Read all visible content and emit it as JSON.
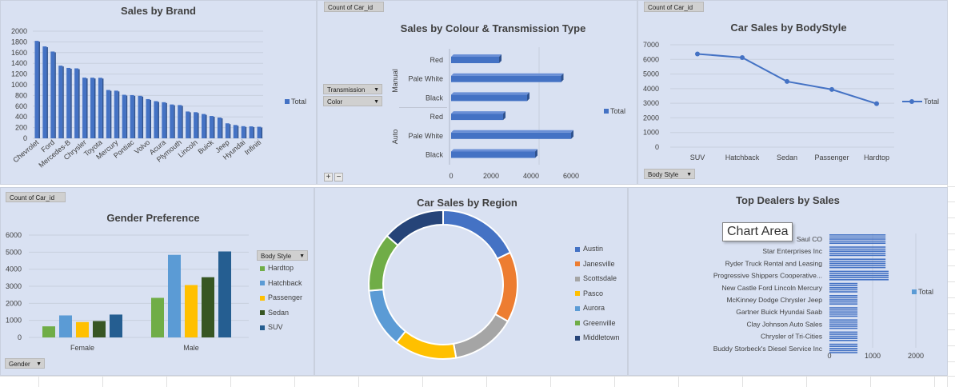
{
  "brand": {
    "title": "Sales by Brand",
    "legend": "Total",
    "chart_data": {
      "type": "bar",
      "title": "Sales by Brand",
      "categories": [
        "Chevrolet",
        "Ford",
        "Mercedes-B",
        "Chrysler",
        "Toyota",
        "Mercury",
        "Pontiac",
        "Volvo",
        "Acura",
        "Plymouth",
        "Lincoln",
        "Buick",
        "Jeep",
        "Hyundai",
        "Infiniti"
      ],
      "values": [
        1819,
        1716,
        1620,
        1357,
        1314,
        1306,
        1133,
        1132,
        1130,
        902,
        890,
        813,
        807,
        794,
        732,
        694,
        674,
        632,
        621,
        501,
        488,
        454,
        417,
        388,
        280,
        249,
        227,
        223,
        216
      ],
      "yticks": [
        0,
        200,
        400,
        600,
        800,
        1000,
        1200,
        1400,
        1600,
        1800,
        2000
      ],
      "ylim": [
        0,
        2000
      ],
      "series": [
        {
          "name": "Total"
        }
      ],
      "legend_position": "right",
      "grid": true
    }
  },
  "colour": {
    "title": "Sales by Colour & Transmission Type",
    "button_count": "Count of Car_id",
    "filter_transmission": "Transmission",
    "filter_color": "Color",
    "legend": "Total",
    "plus": "+",
    "minus": "−",
    "chart_data": {
      "type": "bar",
      "orientation": "horizontal",
      "title": "Sales by Colour & Transmission Type",
      "groups": [
        "Manual",
        "Auto"
      ],
      "categories": [
        "Red",
        "Pale White",
        "Black",
        "Red",
        "Pale White",
        "Black"
      ],
      "category_groups": [
        "Manual",
        "Manual",
        "Manual",
        "Auto",
        "Auto",
        "Auto"
      ],
      "values": [
        2400,
        5500,
        3800,
        2600,
        6000,
        4200
      ],
      "xticks": [
        0,
        2000,
        4000,
        6000
      ],
      "xlim": [
        0,
        7000
      ],
      "series": [
        {
          "name": "Total"
        }
      ],
      "legend_position": "right"
    }
  },
  "body": {
    "title": "Car Sales by BodyStyle",
    "button_count": "Count of Car_id",
    "filter_body": "Body Style",
    "legend": "Total",
    "chart_data": {
      "type": "line",
      "title": "Car Sales by BodyStyle",
      "categories": [
        "SUV",
        "Hatchback",
        "Sedan",
        "Passenger",
        "Hardtop"
      ],
      "values": [
        6374,
        6128,
        4488,
        3945,
        2971
      ],
      "yticks": [
        0,
        1000,
        2000,
        3000,
        4000,
        5000,
        6000,
        7000
      ],
      "ylim": [
        0,
        7000
      ],
      "series": [
        {
          "name": "Total"
        }
      ],
      "legend_position": "right",
      "grid": true
    }
  },
  "gender": {
    "title": "Gender Preference",
    "button_count": "Count of Car_id",
    "filter_gender": "Gender",
    "filter_body": "Body Style",
    "chart_data": {
      "type": "bar",
      "title": "Gender Preference",
      "categories": [
        "Female",
        "Male"
      ],
      "yticks": [
        0,
        1000,
        2000,
        3000,
        4000,
        5000,
        6000
      ],
      "ylim": [
        0,
        6000
      ],
      "series": [
        {
          "name": "Hardtop",
          "values": [
            650,
            2320
          ],
          "color": "#70ad47"
        },
        {
          "name": "Hatchback",
          "values": [
            1290,
            4840
          ],
          "color": "#5b9bd5"
        },
        {
          "name": "Passenger",
          "values": [
            900,
            3070
          ],
          "color": "#ffc000"
        },
        {
          "name": "Sedan",
          "values": [
            960,
            3530
          ],
          "color": "#375623"
        },
        {
          "name": "SUV",
          "values": [
            1340,
            5040
          ],
          "color": "#255e91"
        }
      ],
      "legend_position": "right",
      "grid": true
    }
  },
  "region": {
    "title": "Car Sales by Region",
    "chart_data": {
      "type": "pie",
      "donut": true,
      "title": "Car Sales by Region",
      "labels": [
        "Austin",
        "Janesville",
        "Scottsdale",
        "Pasco",
        "Aurora",
        "Greenville",
        "Middletown"
      ],
      "values": [
        17.9,
        15.3,
        14.0,
        13.6,
        12.9,
        12.7,
        13.6
      ],
      "colors": [
        "#4472c4",
        "#ed7d31",
        "#a5a5a5",
        "#ffc000",
        "#5b9bd5",
        "#70ad47",
        "#264478"
      ],
      "legend_position": "right"
    }
  },
  "dealers": {
    "title": "Top Dealers by Sales",
    "tooltip": "Chart Area",
    "legend": "Total",
    "chart_data": {
      "type": "bar",
      "orientation": "horizontal",
      "title": "Top Dealers by Sales",
      "categories": [
        "Saul CO",
        "Star Enterprises Inc",
        "Ryder Truck Rental and Leasing",
        "Progressive Shippers Cooperative...",
        "New Castle Ford Lincoln Mercury",
        "McKinney Dodge Chrysler Jeep",
        "Gartner Buick Hyundai Saab",
        "Clay Johnson Auto Sales",
        "Chrysler of Tri-Cities",
        "Buddy Storbeck's Diesel Service Inc"
      ],
      "values": [
        1300,
        1300,
        1300,
        1370,
        650,
        650,
        650,
        650,
        650,
        650
      ],
      "xticks": [
        0,
        1000,
        2000
      ],
      "xlim": [
        0,
        2000
      ],
      "series": [
        {
          "name": "Total"
        }
      ],
      "legend_position": "right"
    }
  }
}
